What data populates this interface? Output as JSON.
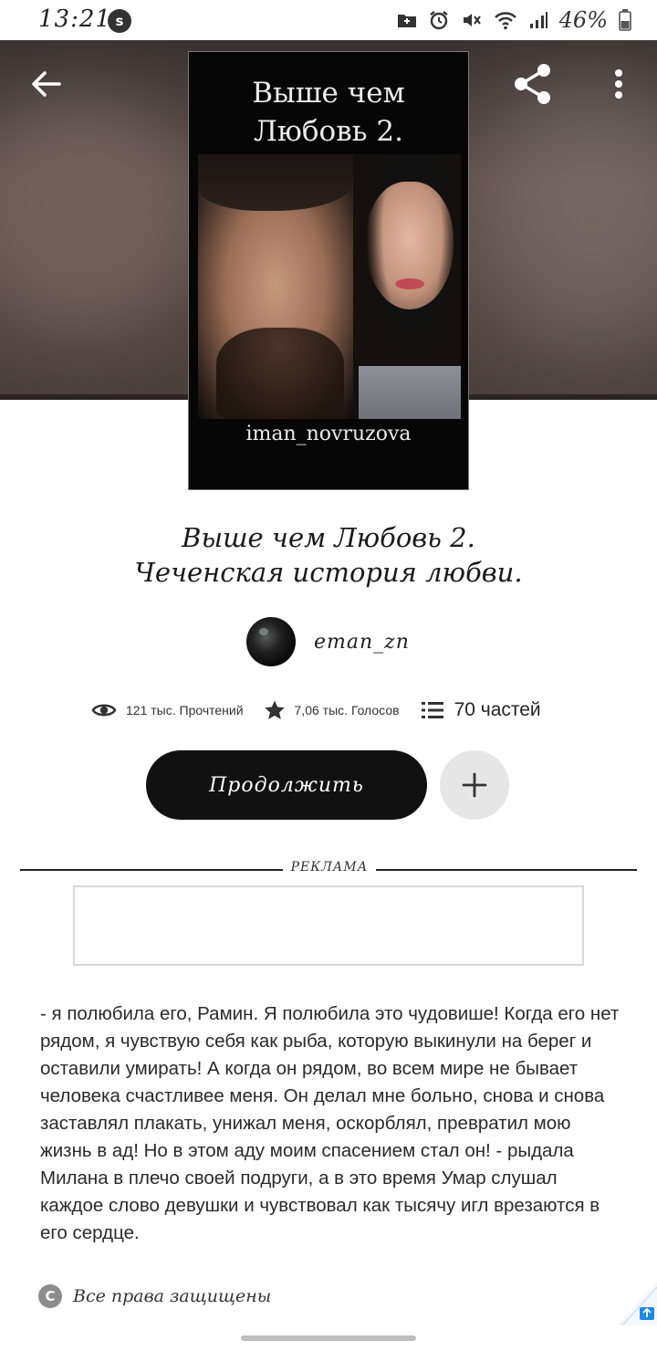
{
  "status_bar": {
    "time": "13:21",
    "battery": "46%"
  },
  "cover": {
    "title_line1": "Выше чем",
    "title_line2": "Любовь 2.",
    "author_handle": "iman_novruzova"
  },
  "story": {
    "title_line1": "Выше чем Любовь 2.",
    "title_line2": "Чеченская история любви.",
    "author": "eman_zn"
  },
  "stats": {
    "reads": "121 тыс. Прочтений",
    "votes": "7,06 тыс. Голосов",
    "parts": "70 частей"
  },
  "actions": {
    "continue_label": "Продолжить"
  },
  "ad": {
    "label": "РЕКЛАМА"
  },
  "description": "- я полюбила его, Рамин. Я полюбила это чудовише! Когда его нет рядом, я чувствую себя как рыба, которую выкинули на берег и оставили умирать! А когда он рядом, во всем мире не бывает человека счастливее меня. Он делал мне больно, снова и снова заставлял плакать, унижал меня, оскорблял, превратил мою жизнь в ад! Но в этом аду моим спасением стал он! - рыдала Милана в плечо своей подруги, а в это время Умар слушал каждое слово девушки и чувствовал как тысячу игл врезаются в его сердце.",
  "copyright": {
    "symbol": "C",
    "text": "Все права защищены"
  },
  "icons": {
    "back": "arrow-left-icon",
    "share": "share-icon",
    "more": "more-vertical-icon",
    "reads": "eye-icon",
    "votes": "star-icon",
    "parts": "list-icon",
    "add": "plus-icon"
  }
}
